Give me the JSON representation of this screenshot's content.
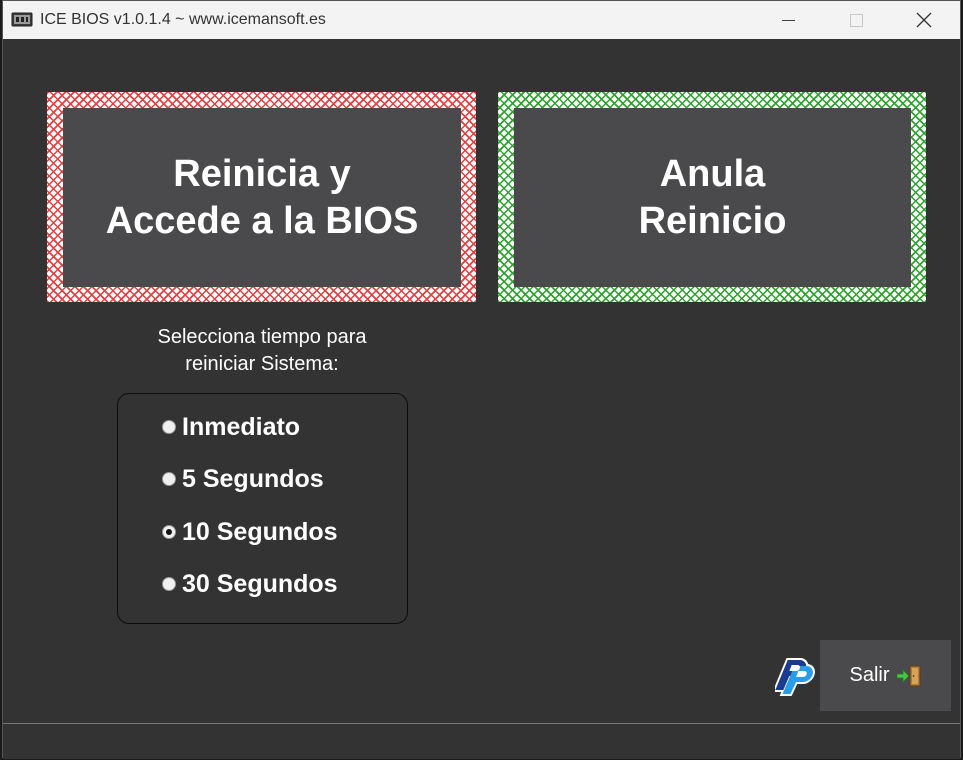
{
  "window": {
    "title": "ICE BIOS v1.0.1.4 ~ www.icemansoft.es",
    "icon": "chip-icon"
  },
  "window_controls": {
    "minimize_icon": "minimize-icon",
    "maximize_icon": "maximize-icon",
    "close_icon": "close-icon"
  },
  "actions": {
    "reboot_bios": {
      "line1": "Reinicia y",
      "line2": "Accede a la BIOS",
      "border_color": "#e04040"
    },
    "cancel_reboot": {
      "line1": "Anula",
      "line2": "Reinicio",
      "border_color": "#2ea02e"
    }
  },
  "timer": {
    "label_line1": "Selecciona tiempo para",
    "label_line2": "reiniciar Sistema:",
    "options": [
      {
        "label": "Inmediato",
        "checked": false
      },
      {
        "label": "5 Segundos",
        "checked": false
      },
      {
        "label": "10 Segundos",
        "checked": true
      },
      {
        "label": "30 Segundos",
        "checked": false
      }
    ]
  },
  "footer": {
    "donate_icon": "paypal-icon",
    "exit_label": "Salir",
    "exit_icon": "exit-door-icon"
  }
}
